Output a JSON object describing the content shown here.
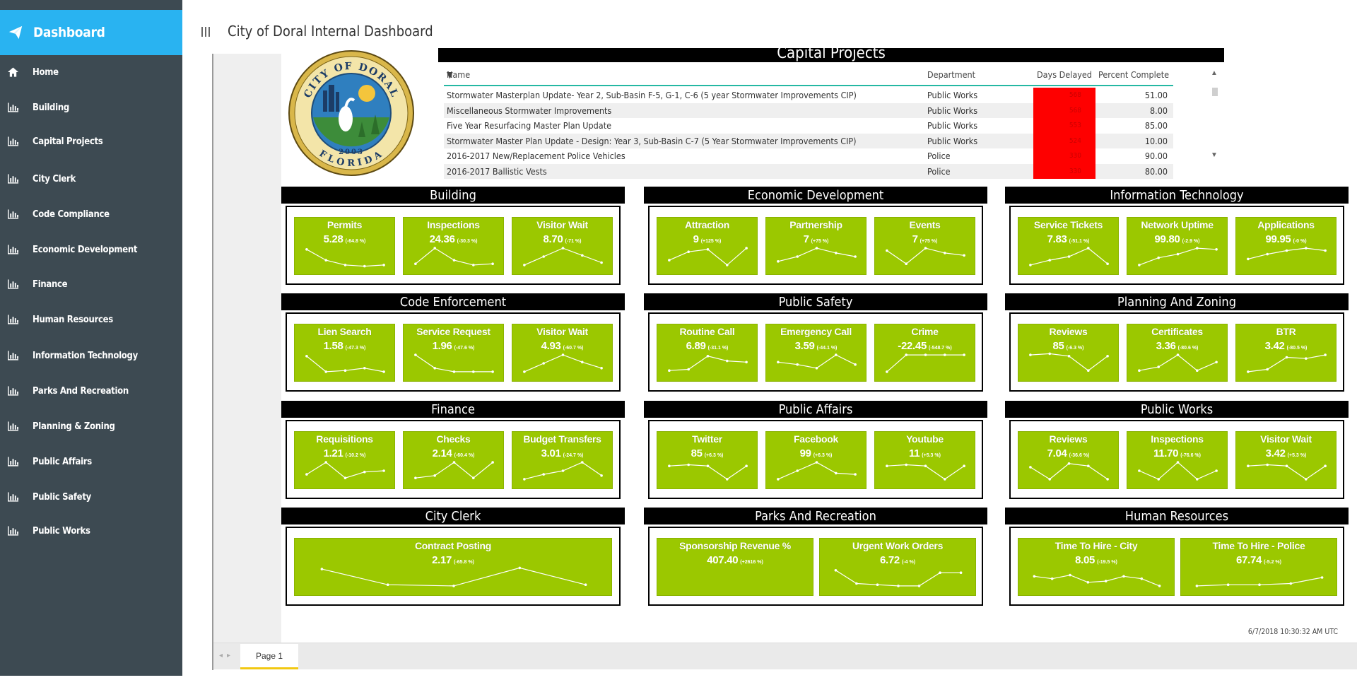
{
  "sidebar": {
    "brand": "Dashboard",
    "items": [
      {
        "label": "Home"
      },
      {
        "label": "Building"
      },
      {
        "label": "Capital Projects"
      },
      {
        "label": "City Clerk"
      },
      {
        "label": "Code Compliance"
      },
      {
        "label": "Economic Development"
      },
      {
        "label": "Finance"
      },
      {
        "label": "Human Resources"
      },
      {
        "label": "Information Technology"
      },
      {
        "label": "Parks And Recreation"
      },
      {
        "label": "Planning & Zoning"
      },
      {
        "label": "Public Affairs"
      },
      {
        "label": "Public Safety"
      },
      {
        "label": "Public Works"
      }
    ]
  },
  "header": {
    "title": "City of Doral Internal Dashboard"
  },
  "logo": {
    "top_text": "CITY OF DORAL",
    "bottom_text": "FLORIDA",
    "year": "2003"
  },
  "capital_projects": {
    "title": "Capital Projects",
    "columns": [
      "Name",
      "Department",
      "Days Delayed",
      "Percent Complete"
    ],
    "rows": [
      {
        "name": "Stormwater Masterplan Update- Year 2, Sub-Basin F-5, G-1, C-6 (5 year Stormwater Improvements CIP)",
        "department": "Public Works",
        "days": "568",
        "pct": "51.00"
      },
      {
        "name": "Miscellaneous Stormwater Improvements",
        "department": "Public Works",
        "days": "568",
        "pct": "8.00"
      },
      {
        "name": "Five Year Resurfacing Master Plan Update",
        "department": "Public Works",
        "days": "553",
        "pct": "85.00"
      },
      {
        "name": "Stormwater Master Plan Update - Design: Year 3, Sub-Basin C-7 (5 Year Stormwater Improvements CIP)",
        "department": "Public Works",
        "days": "524",
        "pct": "10.00"
      },
      {
        "name": "2016-2017 New/Replacement Police Vehicles",
        "department": "Police",
        "days": "330",
        "pct": "90.00"
      },
      {
        "name": "2016-2017 Ballistic Vests",
        "department": "Police",
        "days": "330",
        "pct": "80.00"
      }
    ]
  },
  "panels": [
    {
      "title": "Building",
      "cards": [
        {
          "label": "Permits",
          "value": "5.28",
          "change": "(-64.8 %)",
          "trend": [
            0.8,
            0.35,
            0.15,
            0.1,
            0.15
          ]
        },
        {
          "label": "Inspections",
          "value": "24.36",
          "change": "(-30.3 %)",
          "trend": [
            0.2,
            0.85,
            0.35,
            0.15,
            0.2
          ]
        },
        {
          "label": "Visitor Wait",
          "value": "8.70",
          "change": "(-71 %)",
          "trend": [
            0.15,
            0.5,
            0.85,
            0.55,
            0.25
          ]
        }
      ]
    },
    {
      "title": "Economic Development",
      "cards": [
        {
          "label": "Attraction",
          "value": "9",
          "change": "(+125 %)",
          "trend": [
            0.35,
            0.7,
            0.8,
            0.15,
            0.85
          ]
        },
        {
          "label": "Partnership",
          "value": "7",
          "change": "(+75 %)",
          "trend": [
            0.3,
            0.5,
            0.85,
            0.65,
            0.5
          ]
        },
        {
          "label": "Events",
          "value": "7",
          "change": "(+75 %)",
          "trend": [
            0.75,
            0.2,
            0.85,
            0.65,
            0.55
          ]
        }
      ]
    },
    {
      "title": "Information Technology",
      "cards": [
        {
          "label": "Service Tickets",
          "value": "7.83",
          "change": "(-51.1 %)",
          "trend": [
            0.15,
            0.35,
            0.5,
            0.85,
            0.2
          ]
        },
        {
          "label": "Network Uptime",
          "value": "99.80",
          "change": "(-2.9 %)",
          "trend": [
            0.15,
            0.45,
            0.6,
            0.85,
            0.8
          ]
        },
        {
          "label": "Applications",
          "value": "99.95",
          "change": "(-0 %)",
          "trend": [
            0.4,
            0.6,
            0.75,
            0.85,
            0.75
          ]
        }
      ]
    },
    {
      "title": "Code Enforcement",
      "cards": [
        {
          "label": "Lien Search",
          "value": "1.58",
          "change": "(-47.3 %)",
          "trend": [
            0.8,
            0.15,
            0.2,
            0.3,
            0.15
          ]
        },
        {
          "label": "Service Request",
          "value": "1.96",
          "change": "(-47.6 %)",
          "trend": [
            0.85,
            0.3,
            0.15,
            0.15,
            0.15
          ]
        },
        {
          "label": "Visitor Wait",
          "value": "4.93",
          "change": "(-60.7 %)",
          "trend": [
            0.15,
            0.5,
            0.85,
            0.55,
            0.3
          ]
        }
      ]
    },
    {
      "title": "Public Safety",
      "cards": [
        {
          "label": "Routine Call",
          "value": "6.89",
          "change": "(-31.1 %)",
          "trend": [
            0.2,
            0.25,
            0.8,
            0.6,
            0.55
          ]
        },
        {
          "label": "Emergency Call",
          "value": "3.59",
          "change": "(-44.1 %)",
          "trend": [
            0.55,
            0.45,
            0.3,
            0.85,
            0.45
          ]
        },
        {
          "label": "Crime",
          "value": "-22.45",
          "change": "(-548.7 %)",
          "trend": [
            0.15,
            0.85,
            0.85,
            0.85,
            0.85
          ]
        }
      ]
    },
    {
      "title": "Planning And Zoning",
      "cards": [
        {
          "label": "Reviews",
          "value": "85",
          "change": "(-6.3 %)",
          "trend": [
            0.85,
            0.9,
            0.8,
            0.2,
            0.8
          ]
        },
        {
          "label": "Certificates",
          "value": "3.36",
          "change": "(-80.6 %)",
          "trend": [
            0.2,
            0.35,
            0.85,
            0.2,
            0.55
          ]
        },
        {
          "label": "BTR",
          "value": "3.42",
          "change": "(-80.5 %)",
          "trend": [
            0.15,
            0.25,
            0.75,
            0.7,
            0.85
          ]
        }
      ]
    },
    {
      "title": "Finance",
      "cards": [
        {
          "label": "Requisitions",
          "value": "1.21",
          "change": "(-10.2 %)",
          "trend": [
            0.35,
            0.85,
            0.2,
            0.45,
            0.5
          ]
        },
        {
          "label": "Checks",
          "value": "2.14",
          "change": "(-60.4 %)",
          "trend": [
            0.2,
            0.3,
            0.85,
            0.2,
            0.85
          ]
        },
        {
          "label": "Budget Transfers",
          "value": "3.01",
          "change": "(-24.7 %)",
          "trend": [
            0.15,
            0.35,
            0.5,
            0.85,
            0.3
          ]
        }
      ]
    },
    {
      "title": "Public Affairs",
      "cards": [
        {
          "label": "Twitter",
          "value": "85",
          "change": "(+6.3 %)",
          "trend": [
            0.7,
            0.75,
            0.7,
            0.15,
            0.7
          ]
        },
        {
          "label": "Facebook",
          "value": "99",
          "change": "(+6.3 %)",
          "trend": [
            0.15,
            0.5,
            0.85,
            0.4,
            0.35
          ]
        },
        {
          "label": "Youtube",
          "value": "11",
          "change": "(+5.3 %)",
          "trend": [
            0.7,
            0.75,
            0.7,
            0.15,
            0.7
          ]
        }
      ]
    },
    {
      "title": "Public Works",
      "cards": [
        {
          "label": "Reviews",
          "value": "7.04",
          "change": "(-36.6 %)",
          "trend": [
            0.65,
            0.15,
            0.8,
            0.7,
            0.15
          ]
        },
        {
          "label": "Inspections",
          "value": "11.70",
          "change": "(-76.6 %)",
          "trend": [
            0.5,
            0.15,
            0.85,
            0.15,
            0.5
          ]
        },
        {
          "label": "Visitor Wait",
          "value": "3.42",
          "change": "(+5.3 %)",
          "trend": [
            0.7,
            0.75,
            0.7,
            0.15,
            0.7
          ]
        }
      ]
    },
    {
      "title": "City Clerk",
      "cards": [
        {
          "label": "Contract Posting",
          "value": "2.17",
          "change": "(-65.8 %)",
          "trend": [
            0.85,
            0.2,
            0.15,
            0.9,
            0.2
          ]
        }
      ]
    },
    {
      "title": "Parks And Recreation",
      "cards": [
        {
          "label": "Sponsorship Revenue %",
          "value": "407.40",
          "change": "(+2616 %)",
          "trend": []
        },
        {
          "label": "Urgent Work Orders",
          "value": "6.72",
          "change": "(-4 %)",
          "trend": [
            0.8,
            0.25,
            0.2,
            0.15,
            0.15,
            0.7,
            0.7
          ]
        }
      ]
    },
    {
      "title": "Human Resources",
      "cards": [
        {
          "label": "Time To Hire - City",
          "value": "8.05",
          "change": "(-19.5 %)",
          "trend": [
            0.55,
            0.45,
            0.6,
            0.3,
            0.35,
            0.55,
            0.45,
            0.15
          ]
        },
        {
          "label": "Time To Hire - Police",
          "value": "67.74",
          "change": "(-5.2 %)",
          "trend": [
            0.15,
            0.2,
            0.2,
            0.25,
            0.5
          ]
        }
      ]
    }
  ],
  "footer": {
    "timestamp": "6/7/2018 10:30:32 AM UTC",
    "page_tab": "Page 1"
  }
}
